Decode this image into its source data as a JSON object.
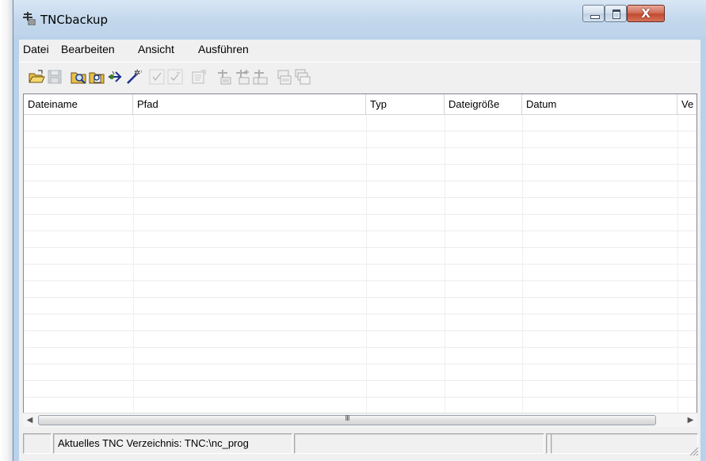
{
  "window": {
    "title": "TNCbackup",
    "app_icon": "network-transfer-icon",
    "controls": {
      "minimize": "minimize-icon",
      "maximize": "maximize-icon",
      "close_label": "X"
    }
  },
  "menubar": {
    "items": [
      {
        "label": "Datei"
      },
      {
        "label": "Bearbeiten"
      },
      {
        "label": "Ansicht"
      },
      {
        "label": "Ausführen"
      }
    ]
  },
  "toolbar": {
    "buttons": [
      {
        "icon": "open-folder-icon",
        "enabled": true
      },
      {
        "icon": "save-icon",
        "enabled": false
      },
      {
        "icon": "search-folder-icon",
        "enabled": true
      },
      {
        "icon": "search-file-icon",
        "enabled": true
      },
      {
        "icon": "connect-icon",
        "enabled": true
      },
      {
        "icon": "wizard-icon",
        "enabled": true
      },
      {
        "icon": "check-icon",
        "enabled": false
      },
      {
        "icon": "check-partial-icon",
        "enabled": false
      },
      {
        "icon": "properties-icon",
        "enabled": false
      },
      {
        "icon": "tnc-transfer-icon",
        "enabled": false
      },
      {
        "icon": "tnc-add-icon",
        "enabled": false
      },
      {
        "icon": "tnc-remove-icon",
        "enabled": false
      },
      {
        "icon": "pc-copy-icon",
        "enabled": false
      },
      {
        "icon": "pc-copy-multi-icon",
        "enabled": false
      }
    ]
  },
  "listview": {
    "columns": [
      {
        "label": "Dateiname"
      },
      {
        "label": "Pfad"
      },
      {
        "label": "Typ"
      },
      {
        "label": "Dateigröße"
      },
      {
        "label": "Datum"
      },
      {
        "label": "Ve"
      }
    ],
    "rows": []
  },
  "scrollbar": {
    "grip": "III",
    "left_arrow": "◀",
    "right_arrow": "▶"
  },
  "statusbar": {
    "panels": [
      {
        "text": ""
      },
      {
        "text": "Aktuelles TNC Verzeichnis: TNC:\\nc_prog"
      },
      {
        "text": ""
      },
      {
        "text": ""
      },
      {
        "text": ""
      }
    ]
  },
  "colors": {
    "title_bar": "#c2d7ec",
    "close_button": "#c24a30",
    "client_bg": "#f0f0f0"
  }
}
